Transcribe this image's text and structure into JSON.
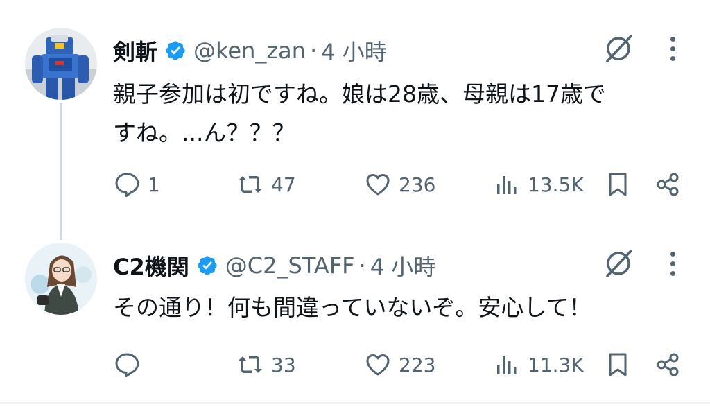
{
  "tweets": [
    {
      "author_name": "剣斬",
      "handle": "@ken_zan",
      "separator": "·",
      "time": "4 小時",
      "text_line1": "親子参加は初ですね。娘は28歳、母親は17歳で",
      "text_line2": "すね。...ん？？？",
      "replies": "1",
      "retweets": "47",
      "likes": "236",
      "views": "13.5K",
      "avatar_icon": "robot-figure-avatar"
    },
    {
      "author_name": "C2機関",
      "handle": "@C2_STAFF",
      "separator": "·",
      "time": "4 小時",
      "text_line1": "その通り！何も間違っていないぞ。安心して！",
      "replies": "",
      "retweets": "33",
      "likes": "223",
      "views": "11.3K",
      "avatar_icon": "anime-character-avatar"
    }
  ],
  "colors": {
    "verified": "#1d9bf0",
    "icon_gray": "#536471",
    "text": "#0f1419",
    "thread_line": "#cfd9de"
  }
}
